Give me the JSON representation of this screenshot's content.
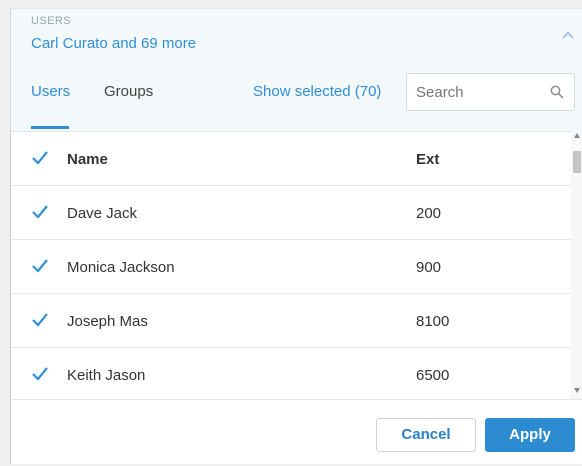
{
  "header": {
    "label": "USERS",
    "summary": "Carl Curato and 69 more"
  },
  "tabs": [
    {
      "label": "Users",
      "active": true
    },
    {
      "label": "Groups",
      "active": false
    }
  ],
  "show_selected": "Show selected (70)",
  "search": {
    "placeholder": "Search",
    "value": ""
  },
  "table": {
    "columns": {
      "name": "Name",
      "ext": "Ext"
    },
    "rows": [
      {
        "name": "Dave Jack",
        "ext": "200",
        "checked": true
      },
      {
        "name": "Monica Jackson",
        "ext": "900",
        "checked": true
      },
      {
        "name": "Joseph Mas",
        "ext": "8100",
        "checked": true
      },
      {
        "name": "Keith Jason",
        "ext": "6500",
        "checked": true
      }
    ]
  },
  "buttons": {
    "cancel": "Cancel",
    "apply": "Apply"
  },
  "colors": {
    "accent": "#2f8fd6",
    "apply_bg": "#2d8bd2",
    "header_bg": "#f3f8fb"
  },
  "icons": {
    "collapse": "chevron-up-icon",
    "search": "search-icon",
    "checkbox": "checkmark-icon"
  }
}
